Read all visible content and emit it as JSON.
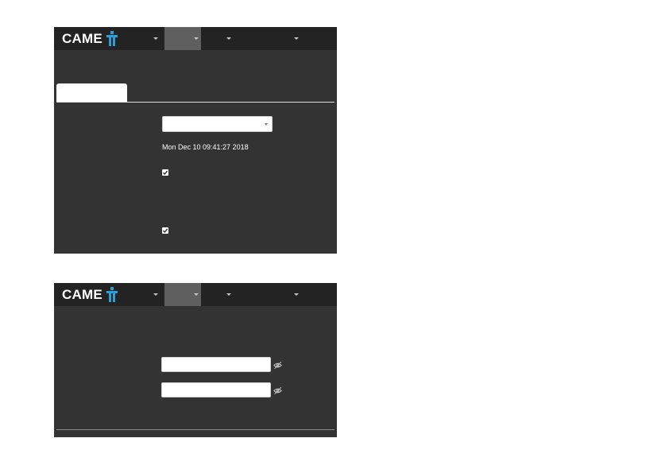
{
  "colors": {
    "panel_bg": "#333333",
    "topbar_bg": "#232323",
    "active_menu_bg": "#5f5f5f",
    "logo_accent": "#2a9fd8"
  },
  "brand": {
    "logo_text": "CAME"
  },
  "menu_icons": [
    "chevron-down-icon",
    "chevron-down-icon",
    "chevron-down-icon",
    "chevron-down-icon"
  ],
  "panel1": {
    "tab_label": "",
    "select_value": "",
    "datetime": "Mon Dec 10 09:41:27 2018",
    "checkbox1_checked": true,
    "checkbox2_checked": true
  },
  "panel2": {
    "password1_value": "",
    "password2_value": "",
    "eye_icon": "eye-slash-icon"
  }
}
